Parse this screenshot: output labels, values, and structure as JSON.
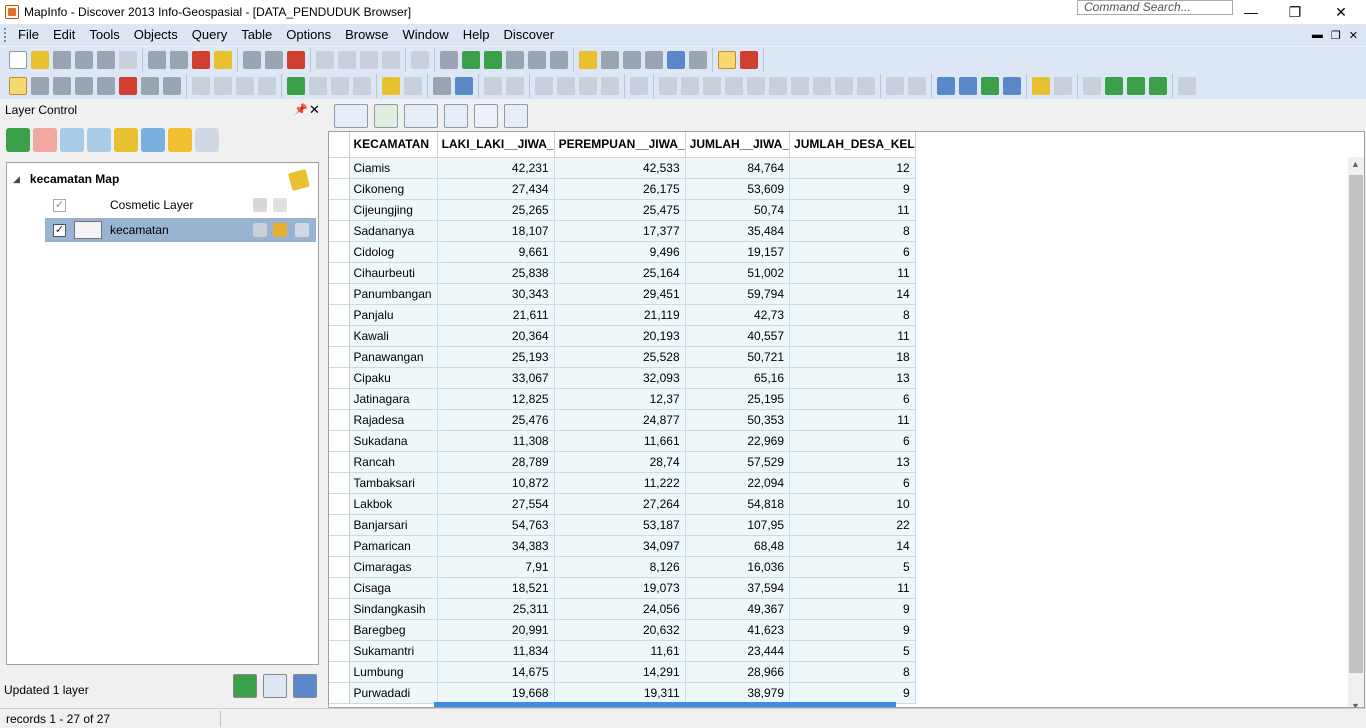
{
  "window": {
    "title": "MapInfo - Discover 2013    Info-Geospasial - [DATA_PENDUDUK Browser]",
    "command_search_placeholder": "Command Search...",
    "controls": {
      "minimize": "—",
      "restore": "❐",
      "close": "✕"
    }
  },
  "menu": {
    "items": [
      "File",
      "Edit",
      "Tools",
      "Objects",
      "Query",
      "Table",
      "Options",
      "Browse",
      "Window",
      "Help",
      "Discover"
    ]
  },
  "layer_control": {
    "title": "Layer Control",
    "pin": "📌",
    "close": "✕",
    "map_name": "kecamatan Map",
    "layers": [
      {
        "name": "Cosmetic Layer",
        "checked": true,
        "selected": false
      },
      {
        "name": "kecamatan",
        "checked": true,
        "selected": true
      }
    ],
    "status": "Updated 1 layer"
  },
  "browser": {
    "columns": [
      "KECAMATAN",
      "LAKI_LAKI__JIWA_",
      "PEREMPUAN__JIWA_",
      "JUMLAH__JIWA_",
      "JUMLAH_DESA_KEL"
    ],
    "rows": [
      [
        "Ciamis",
        "42,231",
        "42,533",
        "84,764",
        "12"
      ],
      [
        "Cikoneng",
        "27,434",
        "26,175",
        "53,609",
        "9"
      ],
      [
        "Cijeungjing",
        "25,265",
        "25,475",
        "50,74",
        "11"
      ],
      [
        "Sadananya",
        "18,107",
        "17,377",
        "35,484",
        "8"
      ],
      [
        "Cidolog",
        "9,661",
        "9,496",
        "19,157",
        "6"
      ],
      [
        "Cihaurbeuti",
        "25,838",
        "25,164",
        "51,002",
        "11"
      ],
      [
        "Panumbangan",
        "30,343",
        "29,451",
        "59,794",
        "14"
      ],
      [
        "Panjalu",
        "21,611",
        "21,119",
        "42,73",
        "8"
      ],
      [
        "Kawali",
        "20,364",
        "20,193",
        "40,557",
        "11"
      ],
      [
        "Panawangan",
        "25,193",
        "25,528",
        "50,721",
        "18"
      ],
      [
        "Cipaku",
        "33,067",
        "32,093",
        "65,16",
        "13"
      ],
      [
        "Jatinagara",
        "12,825",
        "12,37",
        "25,195",
        "6"
      ],
      [
        "Rajadesa",
        "25,476",
        "24,877",
        "50,353",
        "11"
      ],
      [
        "Sukadana",
        "11,308",
        "11,661",
        "22,969",
        "6"
      ],
      [
        "Rancah",
        "28,789",
        "28,74",
        "57,529",
        "13"
      ],
      [
        "Tambaksari",
        "10,872",
        "11,222",
        "22,094",
        "6"
      ],
      [
        "Lakbok",
        "27,554",
        "27,264",
        "54,818",
        "10"
      ],
      [
        "Banjarsari",
        "54,763",
        "53,187",
        "107,95",
        "22"
      ],
      [
        "Pamarican",
        "34,383",
        "34,097",
        "68,48",
        "14"
      ],
      [
        "Cimaragas",
        "7,91",
        "8,126",
        "16,036",
        "5"
      ],
      [
        "Cisaga",
        "18,521",
        "19,073",
        "37,594",
        "11"
      ],
      [
        "Sindangkasih",
        "25,311",
        "24,056",
        "49,367",
        "9"
      ],
      [
        "Baregbeg",
        "20,991",
        "20,632",
        "41,623",
        "9"
      ],
      [
        "Sukamantri",
        "11,834",
        "11,61",
        "23,444",
        "5"
      ],
      [
        "Lumbung",
        "14,675",
        "14,291",
        "28,966",
        "8"
      ],
      [
        "Purwadadi",
        "19,668",
        "19,311",
        "38,979",
        "9"
      ]
    ]
  },
  "statusbar": {
    "records": "records 1 - 27 of 27"
  }
}
